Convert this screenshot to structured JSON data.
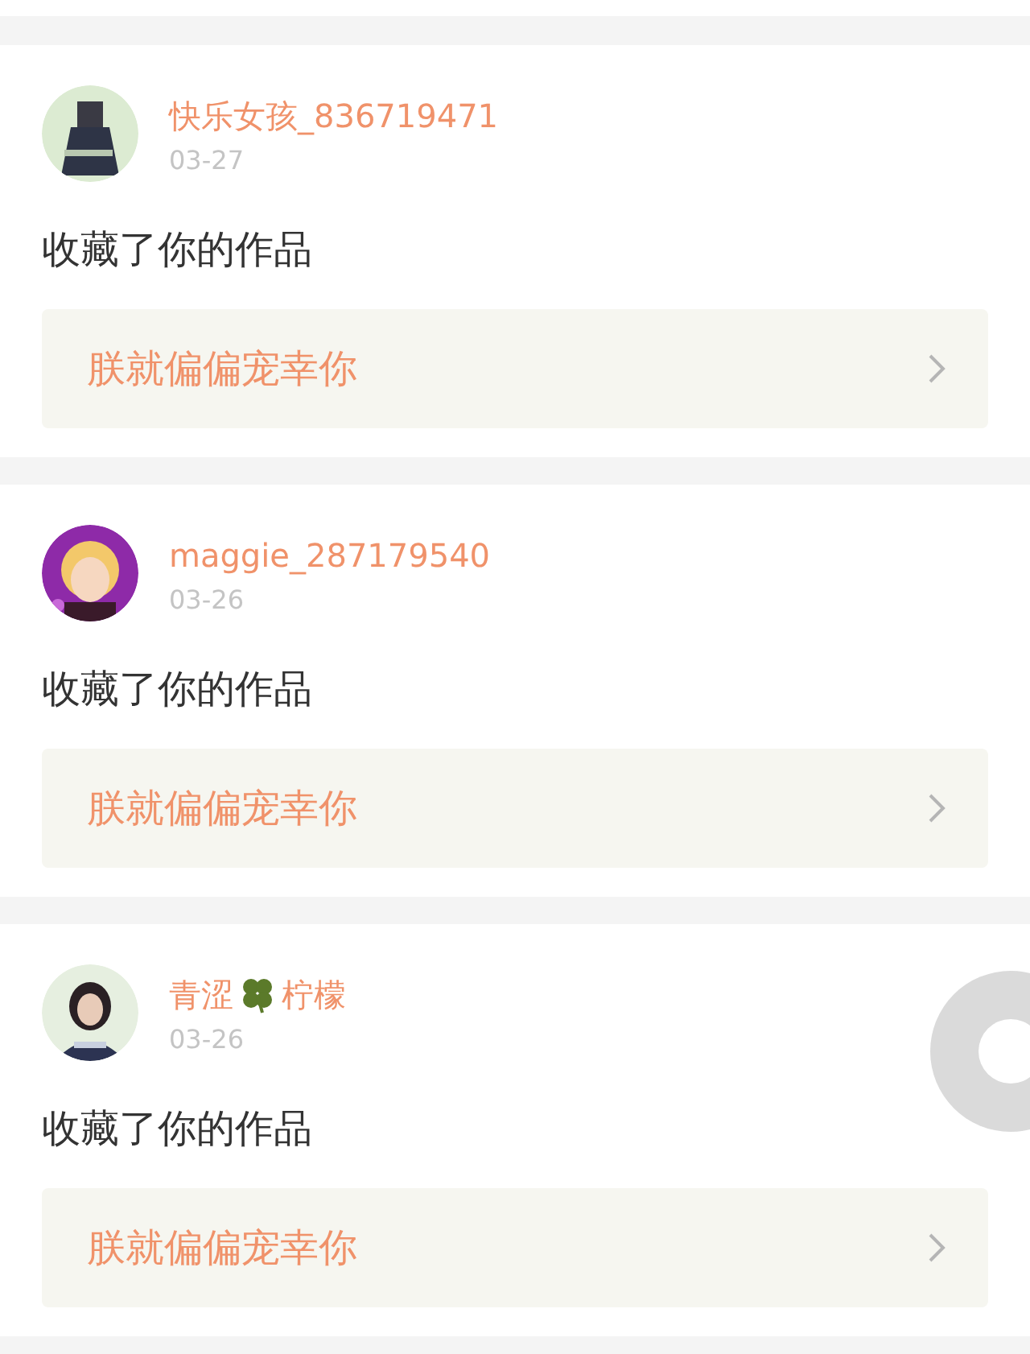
{
  "notifications": [
    {
      "user_name_parts": [
        "快乐女孩_836719471"
      ],
      "date": "03-27",
      "action": "收藏了你的作品",
      "work_title": "朕就偏偏宠幸你",
      "avatar": {
        "kind": "picture"
      }
    },
    {
      "user_name_parts": [
        "maggie_287179540"
      ],
      "date": "03-26",
      "action": "收藏了你的作品",
      "work_title": "朕就偏偏宠幸你",
      "avatar": {
        "kind": "picture"
      }
    },
    {
      "user_name_parts": [
        "青涩",
        "柠檬"
      ],
      "date": "03-26",
      "action": "收藏了你的作品",
      "work_title": "朕就偏偏宠幸你",
      "avatar": {
        "kind": "picture"
      }
    }
  ]
}
